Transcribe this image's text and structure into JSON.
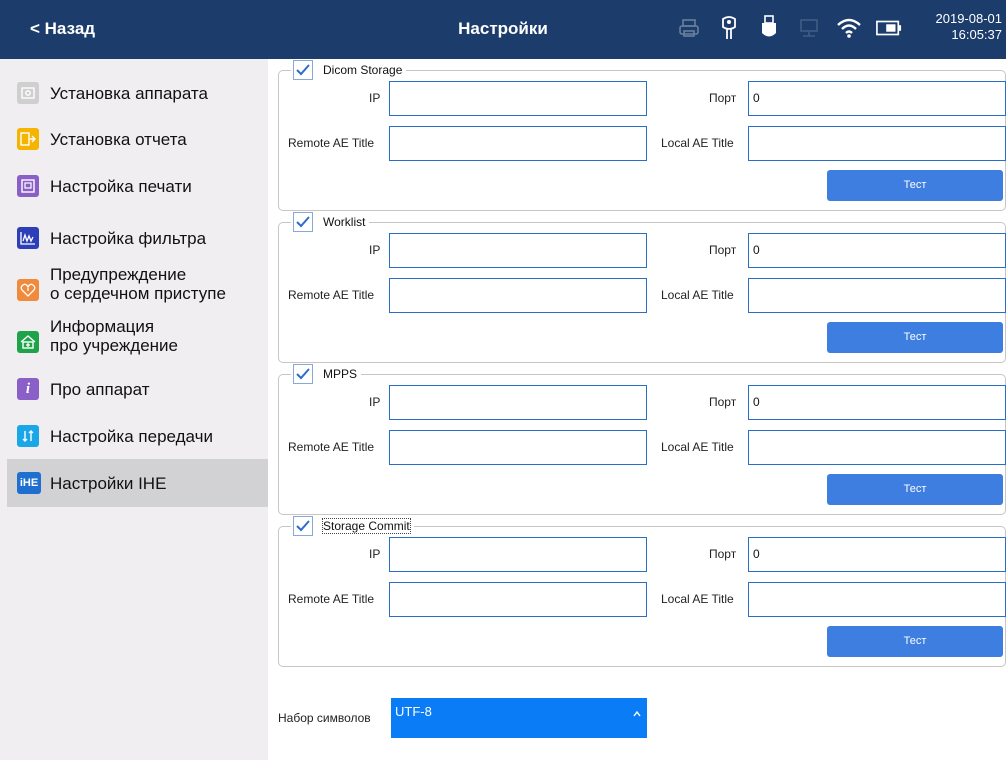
{
  "header": {
    "back_label": "< Назад",
    "title": "Настройки",
    "date": "2019-08-01",
    "time": "16:05:37",
    "status_icons": [
      "printer-icon",
      "probe-icon",
      "usb-icon",
      "network-icon",
      "wifi-icon",
      "battery-icon"
    ]
  },
  "sidebar": {
    "items": [
      {
        "label": "Установка аппарата",
        "icon": "device-icon",
        "color": "#cfcfcf"
      },
      {
        "label": "Установка отчета",
        "icon": "report-icon",
        "color": "#f5b400"
      },
      {
        "label": "Настройка печати",
        "icon": "print-settings-icon",
        "color": "#8a5fc7"
      },
      {
        "label": "Настройка фильтра",
        "icon": "filter-wave-icon",
        "color": "#2d3fb8"
      },
      {
        "label": "Предупреждение\nо сердечном приступе",
        "line1": "Предупреждение",
        "line2": "о сердечном приступе",
        "icon": "heart-alert-icon",
        "color": "#f08a3c"
      },
      {
        "label": "Информация\nпро учреждение",
        "line1": "Информация",
        "line2": "про учреждение",
        "icon": "institution-icon",
        "color": "#1fa34a"
      },
      {
        "label": "Про аппарат",
        "icon": "info-icon",
        "color": "#8a5fc7"
      },
      {
        "label": "Настройка передачи",
        "icon": "transfer-icon",
        "color": "#1aa7e8"
      },
      {
        "label": "Настройки IHE",
        "icon": "ihe-icon",
        "icon_text": "iHE",
        "color": "#1e6fd0"
      }
    ]
  },
  "groups": [
    {
      "title": "Dicom Storage",
      "checked": true,
      "ip_label": "IP",
      "ip_value": "",
      "port_label": "Порт",
      "port_value": "0",
      "remote_label": "Remote AE Title",
      "remote_value": "",
      "local_label": "Local AE Title",
      "local_value": "",
      "test_label": "Тест"
    },
    {
      "title": "Worklist",
      "checked": true,
      "ip_label": "IP",
      "ip_value": "",
      "port_label": "Порт",
      "port_value": "0",
      "remote_label": "Remote AE Title",
      "remote_value": "",
      "local_label": "Local AE Title",
      "local_value": "",
      "test_label": "Тест"
    },
    {
      "title": "MPPS",
      "checked": true,
      "ip_label": "IP",
      "ip_value": "",
      "port_label": "Порт",
      "port_value": "0",
      "remote_label": "Remote AE Title",
      "remote_value": "",
      "local_label": "Local AE Title",
      "local_value": "",
      "test_label": "Тест"
    },
    {
      "title": "Storage Commit",
      "checked": true,
      "ip_label": "IP",
      "ip_value": "",
      "port_label": "Порт",
      "port_value": "0",
      "remote_label": "Remote AE Title",
      "remote_value": "",
      "local_label": "Local AE Title",
      "local_value": "",
      "test_label": "Тест"
    }
  ],
  "charset": {
    "label": "Набор символов",
    "value": "UTF-8"
  },
  "colors": {
    "header_bg": "#1c3d6c",
    "accent": "#3e7ee0",
    "select_bg": "#0a7cf6",
    "active_item_bg": "#d2d2d4"
  }
}
